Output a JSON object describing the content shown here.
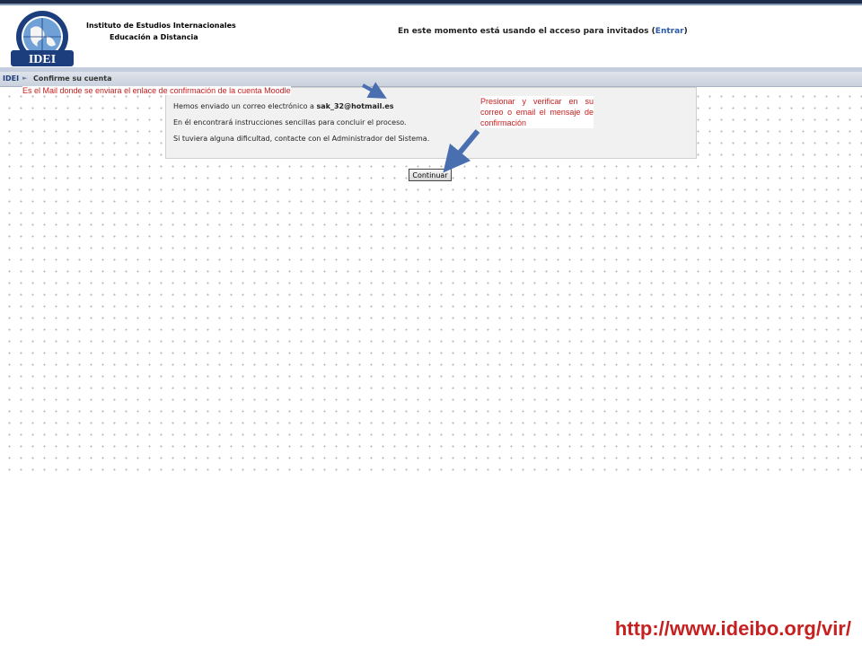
{
  "header": {
    "institution_name": "Instituto de Estudios Internacionales",
    "institution_sub": "Educación a Distancia",
    "logo_text": "IDEI",
    "login_prefix": "En este momento está usando el acceso para invitados (",
    "login_link": "Entrar",
    "login_suffix": ")"
  },
  "breadcrumb": {
    "home": "IDEI",
    "separator": "►",
    "current": "Confirme su cuenta"
  },
  "confirmation": {
    "line1_prefix": "Hemos enviado un correo electrónico a ",
    "email": "sak_32@hotmail.es",
    "line2": "En él encontrará instrucciones sencillas para concluir el proceso.",
    "line3": "Si tuviera alguna dificultad, contacte con el Administrador del Sistema."
  },
  "buttons": {
    "continue_label": "Continuar"
  },
  "annotations": {
    "email_note": "Es el Mail donde  se enviara el enlace de confirmación  de la cuenta Moodle",
    "continue_note": "Presionar   y verificar en su correo o email el mensaje de confirmación"
  },
  "footer": {
    "url": "http://www.ideibo.org/vir/"
  },
  "colors": {
    "annotation": "#c62020",
    "arrow": "#4a6fb0",
    "link": "#2a5aa8"
  }
}
